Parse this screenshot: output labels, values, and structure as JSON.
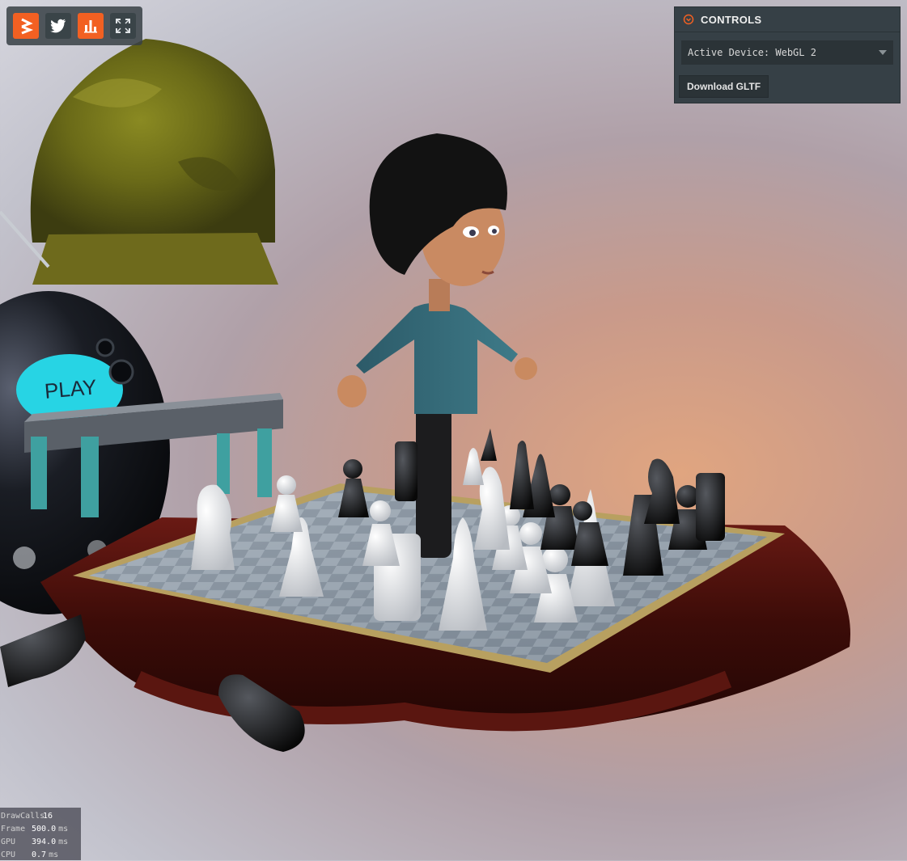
{
  "toolbar": {
    "buttons": [
      {
        "icon": "playcanvas-logo-icon",
        "active": true
      },
      {
        "icon": "twitter-icon",
        "active": false
      },
      {
        "icon": "stats-chart-icon",
        "active": true
      },
      {
        "icon": "fullscreen-icon",
        "active": false
      }
    ]
  },
  "controls": {
    "title": "CONTROLS",
    "device_select": "Active Device: WebGL 2",
    "download_label": "Download GLTF"
  },
  "scene": {
    "play_label": "PLAY"
  },
  "stats": {
    "rows": [
      {
        "label": "DrawCalls",
        "value": "16",
        "unit": ""
      },
      {
        "label": "Frame",
        "value": "500.0",
        "unit": "ms"
      },
      {
        "label": "GPU",
        "value": "394.0",
        "unit": "ms"
      },
      {
        "label": "CPU",
        "value": "0.7",
        "unit": "ms"
      }
    ]
  },
  "colors": {
    "accent": "#f26022",
    "panel": "#364046",
    "panel_dark": "#2b3337"
  }
}
